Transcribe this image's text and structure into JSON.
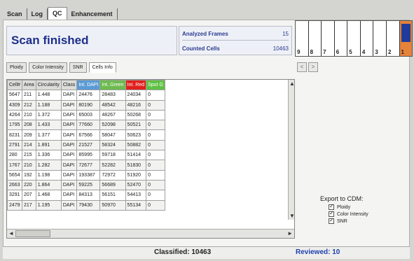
{
  "top_tabs": [
    "Scan",
    "Log",
    "QC",
    "Enhancement"
  ],
  "status": "Scan finished",
  "stats": {
    "analyzed_frames_label": "Analyzed Frames",
    "analyzed_frames_value": "15",
    "counted_cells_label": "Counted Cells",
    "counted_cells_value": "10463"
  },
  "frames": [
    "9",
    "8",
    "7",
    "6",
    "5",
    "4",
    "3",
    "2",
    "1"
  ],
  "sub_tabs": [
    "Ploidy",
    "Color Intensity",
    "SNR",
    "Cells Info"
  ],
  "nav": {
    "prev": "<",
    "next": ">"
  },
  "table": {
    "columns": [
      "Cell#",
      "Area",
      "Circularity",
      "Class",
      "Int. DAPI",
      "Int. Green",
      "Int. Red",
      "Spot G"
    ],
    "rows": [
      [
        "5647",
        "211",
        "1.448",
        "DAPI",
        "24476",
        "28483",
        "24034",
        "0"
      ],
      [
        "4309",
        "212",
        "1.188",
        "DAPI",
        "80190",
        "48542",
        "48216",
        "0"
      ],
      [
        "4264",
        "210",
        "1.372",
        "DAPI",
        "65003",
        "48267",
        "50268",
        "0"
      ],
      [
        "1795",
        "208",
        "1.433",
        "DAPI",
        "77660",
        "52098",
        "50521",
        "0"
      ],
      [
        "8231",
        "209",
        "1.377",
        "DAPI",
        "67566",
        "58047",
        "50623",
        "0"
      ],
      [
        "2791",
        "214",
        "1.891",
        "DAPI",
        "21527",
        "58324",
        "50882",
        "0"
      ],
      [
        "280",
        "215",
        "1.336",
        "DAPI",
        "85995",
        "59718",
        "51414",
        "0"
      ],
      [
        "1767",
        "210",
        "1.282",
        "DAPI",
        "72677",
        "52282",
        "51830",
        "0"
      ],
      [
        "5654",
        "192",
        "1.198",
        "DAPI",
        "193387",
        "72972",
        "51920",
        "0"
      ],
      [
        "2663",
        "220",
        "1.864",
        "DAPI",
        "59225",
        "56689",
        "52470",
        "0"
      ],
      [
        "3291",
        "207",
        "1.468",
        "DAPI",
        "84313",
        "56151",
        "54413",
        "0"
      ],
      [
        "2479",
        "217",
        "1.195",
        "DAPI",
        "79430",
        "50970",
        "55134",
        "0"
      ]
    ]
  },
  "export": {
    "title": "Export to CDM:",
    "items": [
      "Ploidy",
      "Color Intensity",
      "SNR"
    ]
  },
  "bottom": {
    "classified": "Classified: 10463",
    "reviewed": "Reviewed: 10"
  },
  "colors": {
    "title_blue": "#1d2f8a",
    "dapi_header": "#5b9bd5",
    "green_header": "#6dbb4f",
    "red_header": "#e0201d",
    "frame_selected": "#e6833a",
    "frame_fill": "#1f3c9c"
  }
}
